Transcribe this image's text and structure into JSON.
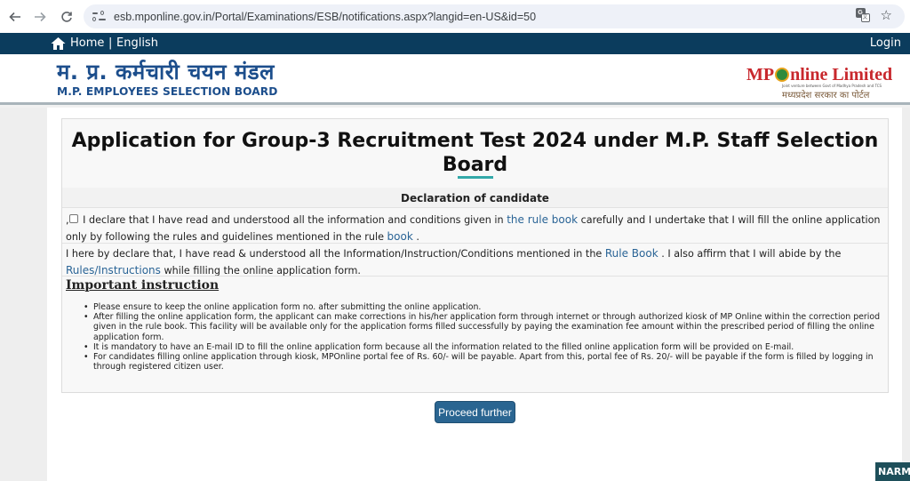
{
  "browser": {
    "url": "esb.mponline.gov.in/Portal/Examinations/ESB/notifications.aspx?langid=en-US&id=50",
    "back_icon": "arrow-left",
    "forward_icon": "arrow-right",
    "reload_icon": "reload",
    "site_info_icon": "tune",
    "translate_icon": "translate",
    "bookmark_icon": "star"
  },
  "site_nav": {
    "home_label": "Home",
    "separator": "|",
    "language_label": "English",
    "login_label": "Login"
  },
  "header": {
    "logo_hindi": "म. प्र. कर्मचारी चयन मंडल",
    "logo_english": "M.P. EMPLOYEES SELECTION BOARD",
    "partner_logo_prefix": "MP",
    "partner_logo_suffix": "nline Limited",
    "partner_tagline": "Joint venture between Govt of Madhya Pradesh and TCS",
    "partner_hindi": "मध्यप्रदेश सरकार का पोर्टल"
  },
  "main": {
    "title": "Application for Group-3 Recruitment Test 2024 under M.P. Staff Selection Board",
    "declaration_heading": "Declaration of candidate",
    "declaration1": {
      "prefix": ",",
      "checked": false,
      "text_before_link": " I declare that I have read and understood all the information and conditions given in ",
      "link1": "the rule book",
      "text_middle": " carefully and I undertake that I will fill the online application only by following the rules and guidelines mentioned in the rule ",
      "link2": "book",
      "text_end": " ."
    },
    "declaration2": {
      "text_before_link": "I here by declare that, I have read & understood all the Information/Instruction/Conditions mentioned in the ",
      "link1": "Rule Book",
      "text_middle": " . I also affirm that I will abide by the ",
      "link2": "Rules/Instructions",
      "text_end": " while filling the online application form."
    },
    "important_heading": "Important instruction",
    "instructions": [
      "Please ensure to keep the online application form no. after submitting the online application.",
      "After filling the online application form, the applicant can make corrections in his/her application form through internet or through authorized kiosk of MP Online within the correction period given in the rule book. This facility will be available only for the application forms filled successfully by paying the examination fee amount within the prescribed period of filling the online application form.",
      "It is mandatory to have an E-mail ID to fill the online application form because all the information related to the filled online application form will be provided on E-mail.",
      "For candidates filling online application through kiosk, MPOnline portal fee of Rs. 60/- will be payable. Apart from this, portal fee of Rs. 20/- will be payable if the form is filled by logging in through registered citizen user."
    ],
    "proceed_button": "Proceed further"
  },
  "corner_badge": "NARM",
  "colors": {
    "nav_bar": "#0b3c5d",
    "brand_blue": "#1c4e8c",
    "link": "#2a6496",
    "button": "#2a6591",
    "accent_underline": "#33a9a9",
    "mponline_red": "#c8282d"
  }
}
